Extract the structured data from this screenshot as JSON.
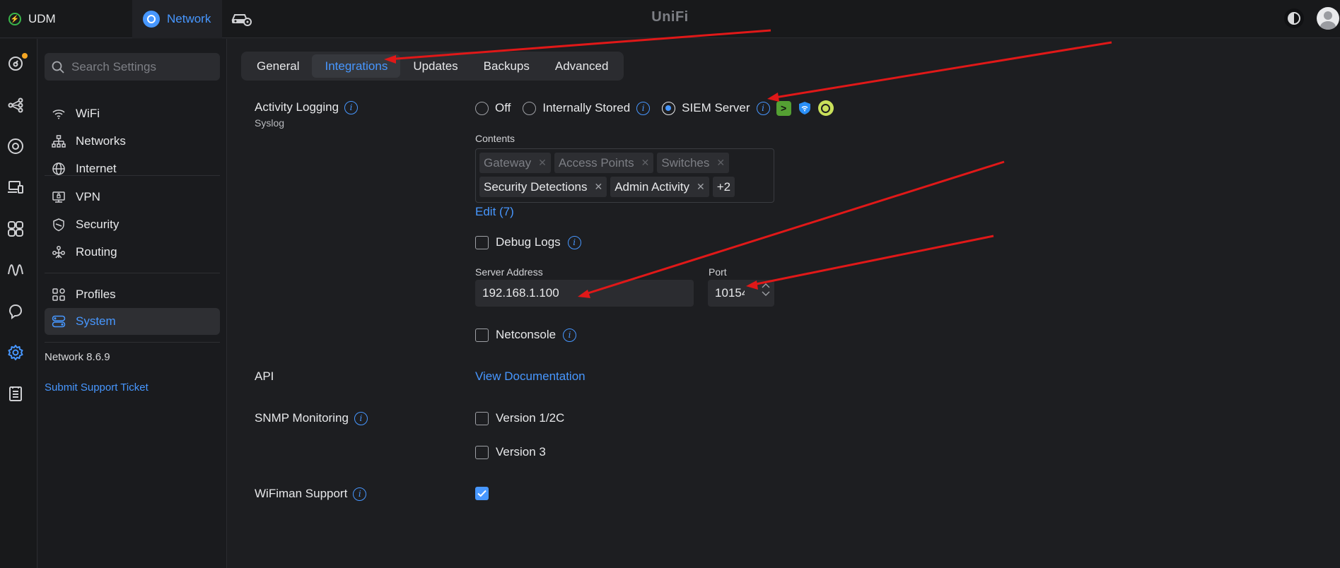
{
  "topbar": {
    "udm_label": "UDM",
    "network_label": "Network",
    "brand": "UniFi"
  },
  "rail": {
    "icons": [
      "dashboard-icon",
      "topology-icon",
      "devices-icon",
      "clients-icon",
      "apps-icon",
      "insights-icon",
      "alerts-icon",
      "settings-icon",
      "logs-icon"
    ]
  },
  "sidebar": {
    "search_placeholder": "Search Settings",
    "items": [
      {
        "label": "WiFi",
        "icon": "wifi-icon"
      },
      {
        "label": "Networks",
        "icon": "networks-icon"
      },
      {
        "label": "Internet",
        "icon": "globe-icon"
      },
      {
        "label": "VPN",
        "icon": "vpn-icon"
      },
      {
        "label": "Security",
        "icon": "shield-icon"
      },
      {
        "label": "Routing",
        "icon": "routing-icon"
      },
      {
        "label": "Profiles",
        "icon": "profiles-icon"
      },
      {
        "label": "System",
        "icon": "system-icon"
      }
    ],
    "version": "Network 8.6.9",
    "support": "Submit Support Ticket"
  },
  "tabs": [
    "General",
    "Integrations",
    "Updates",
    "Backups",
    "Advanced"
  ],
  "active_tab": "Integrations",
  "activity_logging": {
    "label": "Activity Logging",
    "sublabel": "Syslog",
    "options": [
      "Off",
      "Internally Stored",
      "SIEM Server"
    ],
    "selected": "SIEM Server",
    "contents_label": "Contents",
    "chips": [
      {
        "label": "Gateway",
        "dim": true
      },
      {
        "label": "Access Points",
        "dim": true
      },
      {
        "label": "Switches",
        "dim": true
      },
      {
        "label": "Security Detections",
        "dim": false
      },
      {
        "label": "Admin Activity",
        "dim": false
      }
    ],
    "more_chip": "+2",
    "edit_link": "Edit (7)",
    "debug_logs": "Debug Logs",
    "server_address_label": "Server Address",
    "server_address_value": "192.168.1.100",
    "port_label": "Port",
    "port_value": "10154",
    "netconsole": "Netconsole"
  },
  "api": {
    "label": "API",
    "link": "View Documentation"
  },
  "snmp": {
    "label": "SNMP Monitoring",
    "v12c": "Version 1/2C",
    "v3": "Version 3"
  },
  "wifiman": {
    "label": "WiFiman Support",
    "checked": true
  },
  "colors": {
    "accent": "#4797ff",
    "annotation": "#e01818"
  }
}
